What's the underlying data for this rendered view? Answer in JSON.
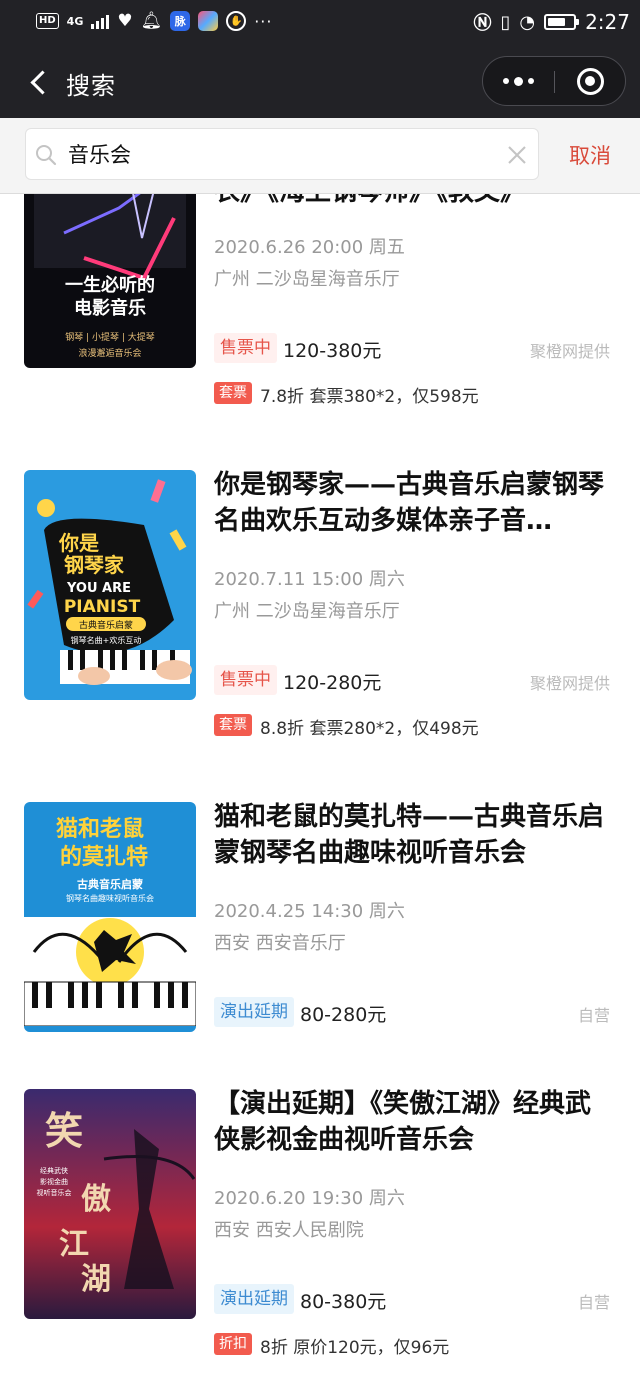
{
  "status_bar": {
    "network": "4G",
    "hd": "HD",
    "time": "2:27",
    "battery_level": 0.7,
    "app_icons": [
      "heart-pulse-icon",
      "bell-icon",
      "baidu-icon",
      "app-icon",
      "shield-icon"
    ],
    "right_icons": [
      "nfc-icon",
      "vibrate-icon",
      "data-saver-icon"
    ]
  },
  "nav": {
    "title": "搜索"
  },
  "search": {
    "query": "音乐会",
    "cancel_label": "取消"
  },
  "colors": {
    "accent": "#d94a3a",
    "badge_red": "#e6554a",
    "badge_blue": "#3d8bd1",
    "promo": "#f25b4e"
  },
  "results": [
    {
      "title": "衣》《海上钢琴师》《教父》",
      "date": "2020.6.26 20:00 周五",
      "venue": "广州 二沙岛星海音乐厅",
      "status": "售票中",
      "price": "120-380元",
      "provider": "聚橙网提供",
      "promo_tag": "套票",
      "promo_text": "7.8折  套票380*2，仅598元",
      "poster_text": [
        "一生必听的",
        "电影音乐",
        "钢琴 | 小提琴 | 大提琴",
        "浪漫邂逅音乐会"
      ]
    },
    {
      "title": "你是钢琴家——古典音乐启蒙钢琴名曲欢乐互动多媒体亲子音…",
      "date": "2020.7.11 15:00 周六",
      "venue": "广州 二沙岛星海音乐厅",
      "status": "售票中",
      "price": "120-280元",
      "provider": "聚橙网提供",
      "promo_tag": "套票",
      "promo_text": "8.8折  套票280*2，仅498元",
      "poster_text": [
        "你是",
        "钢琴家",
        "YOU ARE",
        "PIANIST",
        "古典音乐启蒙",
        "钢琴名曲+欢乐互动"
      ]
    },
    {
      "title": "猫和老鼠的莫扎特——古典音乐启蒙钢琴名曲趣味视听音乐会",
      "date": "2020.4.25 14:30 周六",
      "venue": "西安 西安音乐厅",
      "status": "演出延期",
      "price": "80-280元",
      "provider": "自营",
      "poster_text": [
        "猫和老鼠",
        "的莫扎特",
        "古典音乐启蒙",
        "钢琴名曲趣味视听音乐会"
      ]
    },
    {
      "title": "【演出延期】《笑傲江湖》经典武侠影视金曲视听音乐会",
      "date": "2020.6.20 19:30 周六",
      "venue": "西安 西安人民剧院",
      "status": "演出延期",
      "price": "80-380元",
      "provider": "自营",
      "promo_tag": "折扣",
      "promo_text": "8折  原价120元，仅96元",
      "poster_text": [
        "笑",
        "傲",
        "江",
        "湖",
        "经典武侠",
        "影视金曲",
        "视听音乐会"
      ]
    }
  ]
}
